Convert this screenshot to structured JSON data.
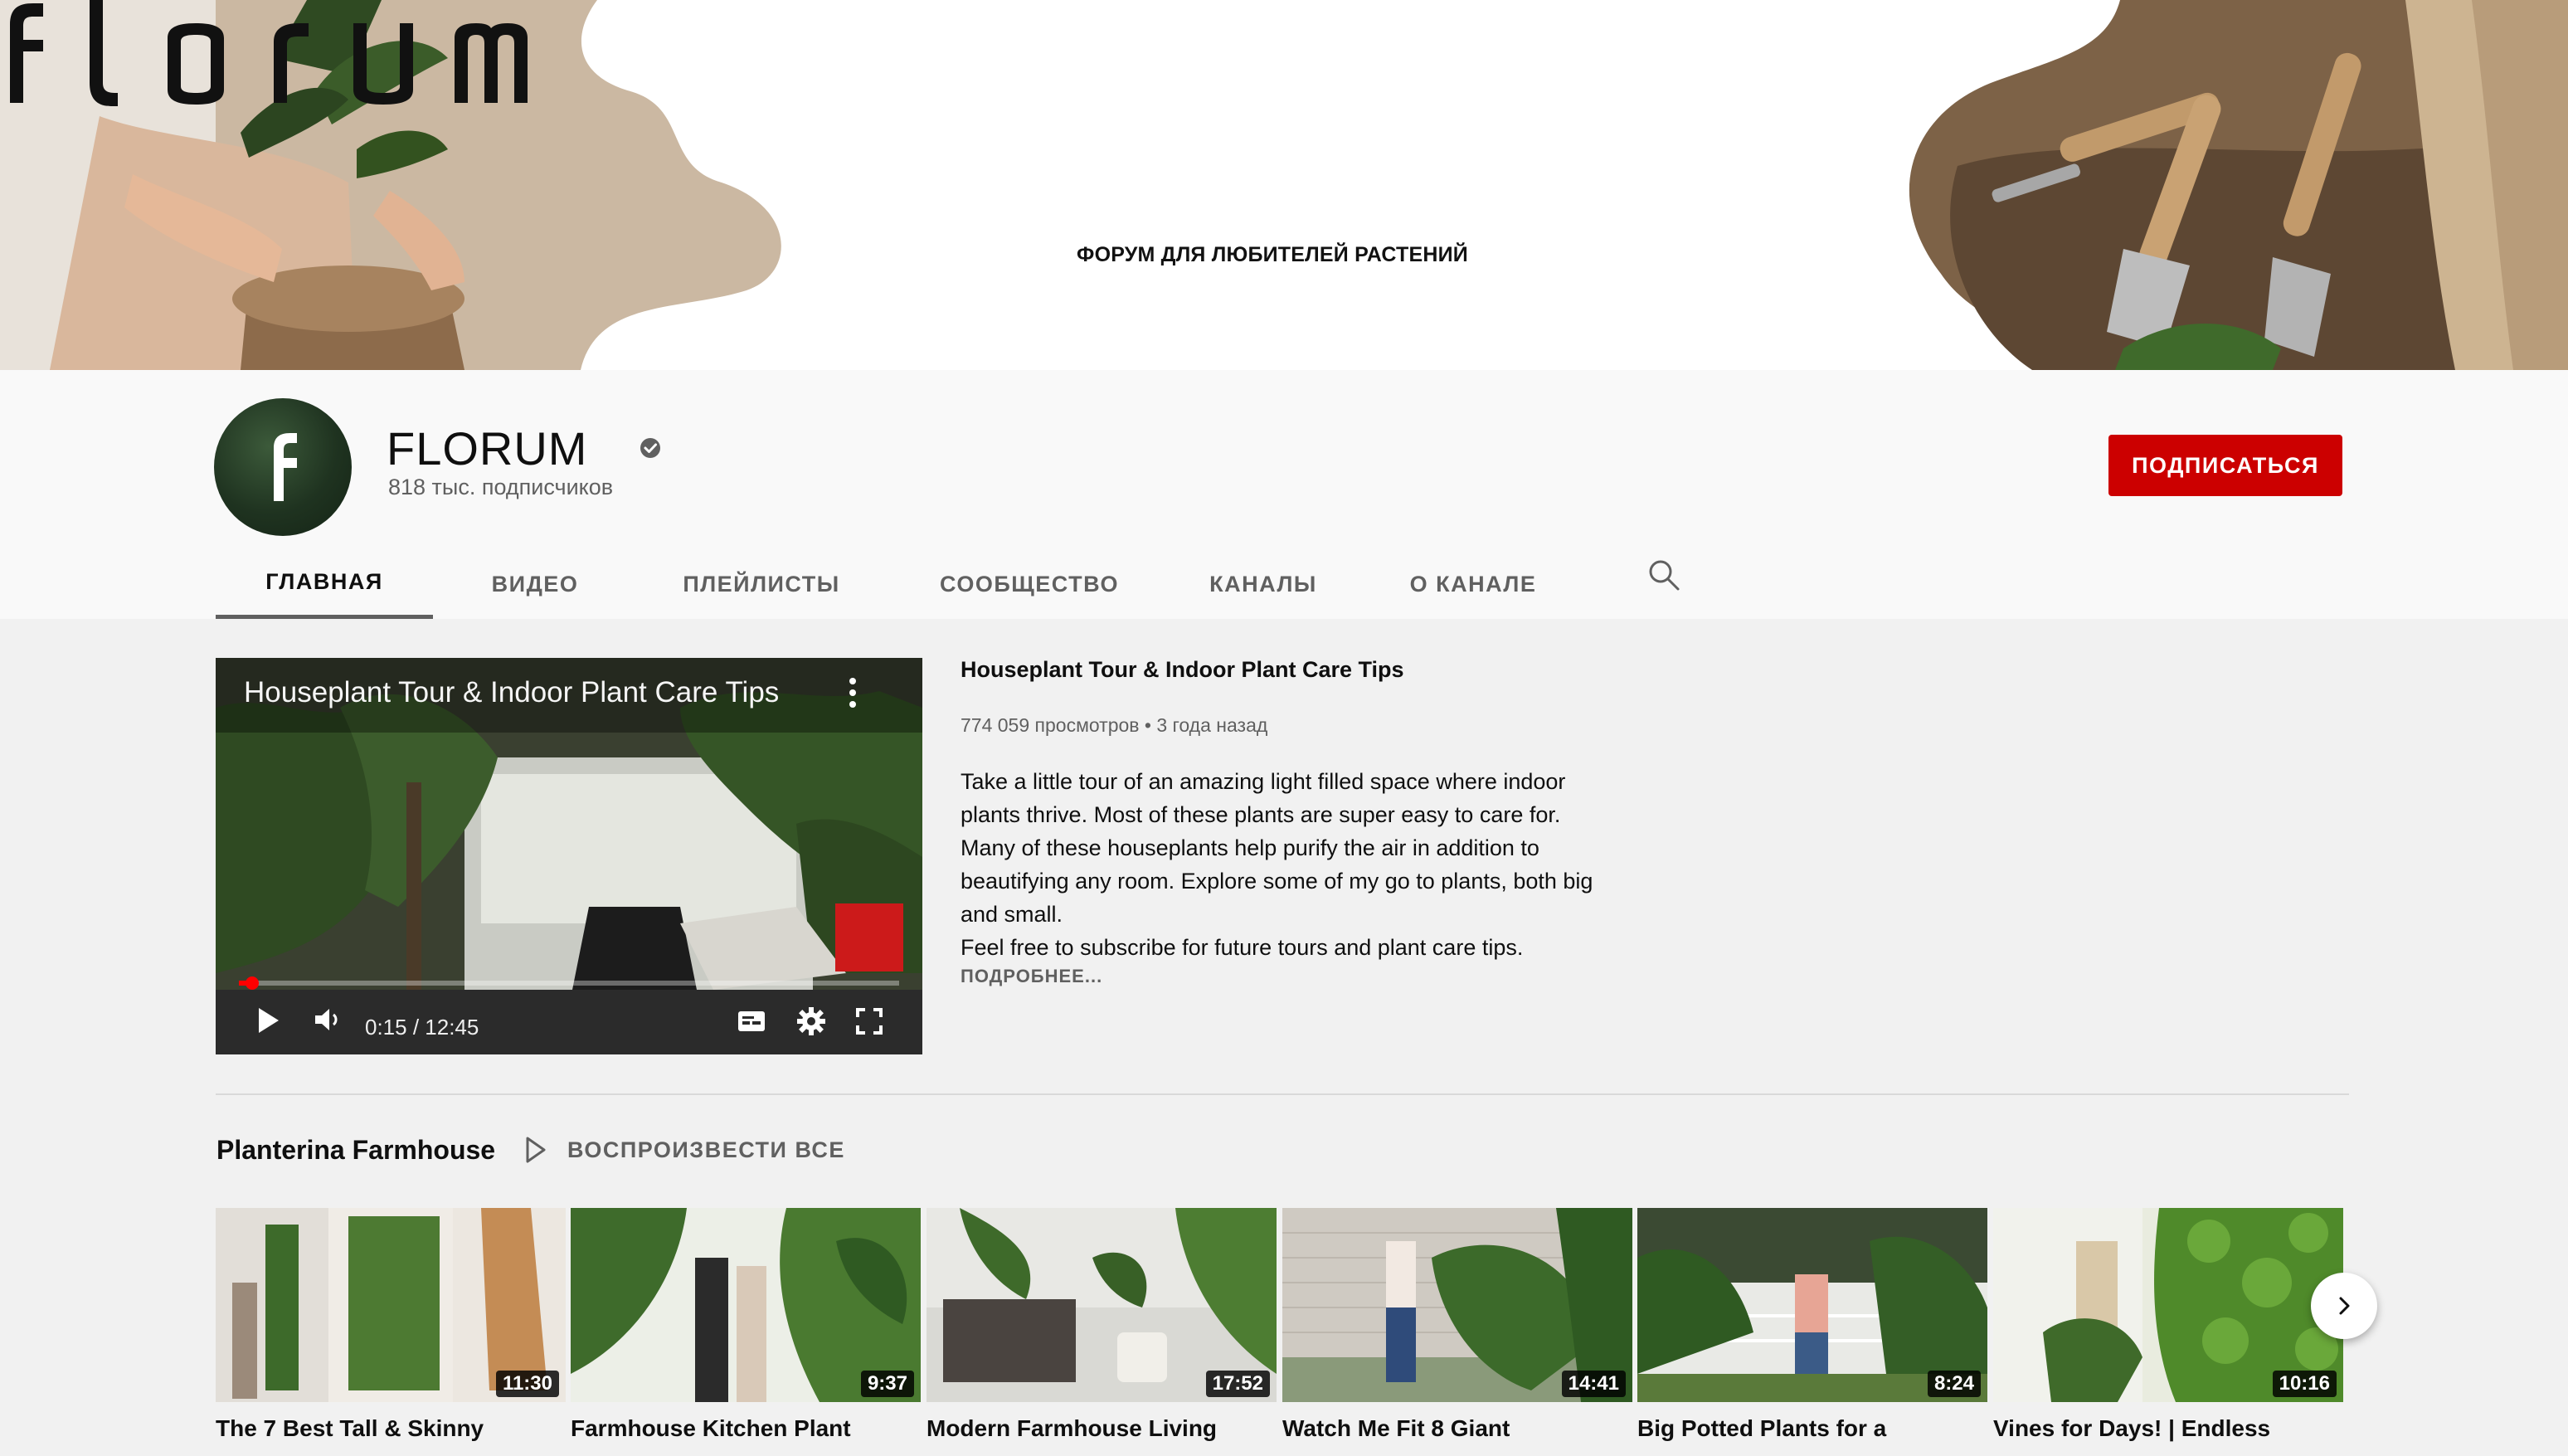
{
  "banner": {
    "logo_text": "florum",
    "subtitle": "ФОРУМ ДЛЯ ЛЮБИТЕЛЕЙ РАСТЕНИЙ"
  },
  "channel": {
    "name": "FLORUM",
    "subscribers": "818 тыс. подписчиков",
    "verified": true,
    "subscribe_label": "ПОДПИСАТЬСЯ",
    "subscribe_color": "#cc0000"
  },
  "tabs": [
    {
      "label": "ГЛАВНАЯ",
      "active": true
    },
    {
      "label": "ВИДЕО",
      "active": false
    },
    {
      "label": "ПЛЕЙЛИСТЫ",
      "active": false
    },
    {
      "label": "СООБЩЕСТВО",
      "active": false
    },
    {
      "label": "КАНАЛЫ",
      "active": false
    },
    {
      "label": "О КАНАЛЕ",
      "active": false
    }
  ],
  "featured": {
    "overlay_title": "Houseplant Tour & Indoor Plant Care Tips",
    "time": "0:15 / 12:45",
    "progress_fraction": 0.02,
    "title": "Houseplant Tour & Indoor Plant Care Tips",
    "meta": "774 059 просмотров • 3 года назад",
    "description_lines": [
      "Take a little tour of an amazing light filled space where indoor",
      "plants thrive. Most of these plants are super easy to care for.",
      "Many of these houseplants help purify the air in addition to",
      "beautifying any room. Explore some of my go to plants, both big",
      "and small.",
      "Feel free to subscribe for future tours and plant care tips."
    ],
    "more_label": "ПОДРОБНЕЕ..."
  },
  "shelf": {
    "title": "Planterina Farmhouse",
    "play_all_label": "ВОСПРОИЗВЕСТИ ВСЕ",
    "videos": [
      {
        "title": "The 7 Best Tall & Skinny",
        "duration": "11:30"
      },
      {
        "title": "Farmhouse Kitchen Plant",
        "duration": "9:37"
      },
      {
        "title": "Modern Farmhouse Living",
        "duration": "17:52"
      },
      {
        "title": "Watch Me Fit 8 Giant",
        "duration": "14:41"
      },
      {
        "title": "Big Potted Plants for a",
        "duration": "8:24"
      },
      {
        "title": "Vines for Days! | Endless",
        "duration": "10:16"
      }
    ]
  }
}
